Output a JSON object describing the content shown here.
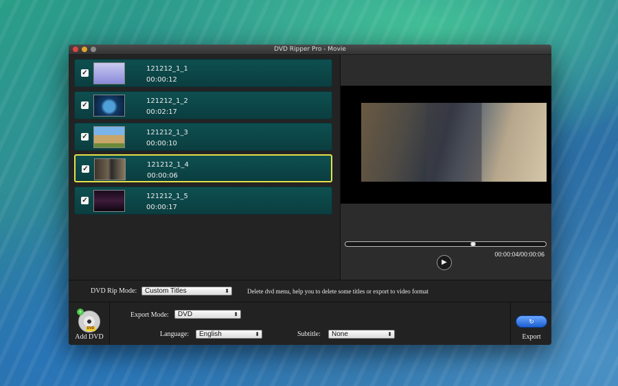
{
  "window": {
    "title": "DVD Ripper Pro - Movie"
  },
  "titles": [
    {
      "name": "121212_1_1",
      "duration": "00:00:12",
      "checked": "✓"
    },
    {
      "name": "121212_1_2",
      "duration": "00:02:17",
      "checked": "✓"
    },
    {
      "name": "121212_1_3",
      "duration": "00:00:10",
      "checked": "✓"
    },
    {
      "name": "121212_1_4",
      "duration": "00:00:06",
      "checked": "✓"
    },
    {
      "name": "121212_1_5",
      "duration": "00:00:17",
      "checked": "✓"
    }
  ],
  "selected_index": 3,
  "player": {
    "time": "00:00:04/00:00:06",
    "progress": 0.64,
    "play_glyph": "▶"
  },
  "rip_mode": {
    "label": "DVD Rip Mode:",
    "value": "Custom Titles",
    "hint": "Delete dvd menu, help you to delete some titles or export to video format"
  },
  "export_mode": {
    "label": "Export Mode:",
    "value": "DVD"
  },
  "language": {
    "label": "Language:",
    "value": "English"
  },
  "subtitle": {
    "label": "Subtitle:",
    "value": "None"
  },
  "add_dvd": {
    "label": "Add DVD",
    "badge": "DVD",
    "plus": "+"
  },
  "export": {
    "label": "Export",
    "glyph": "↻"
  },
  "select_arrow": "⬍"
}
